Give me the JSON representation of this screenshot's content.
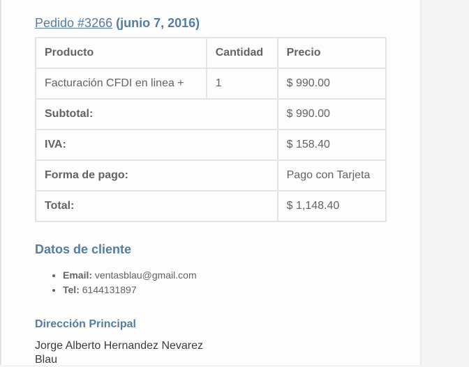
{
  "order": {
    "link_text": "Pedido #3266",
    "date_text": "(junio 7, 2016)"
  },
  "table": {
    "headers": [
      "Producto",
      "Cantidad",
      "Precio"
    ],
    "item": {
      "product": "Facturación CFDI en linea +",
      "quantity": "1",
      "price": "$ 990.00"
    },
    "totals": [
      {
        "label": "Subtotal:",
        "value": "$ 990.00"
      },
      {
        "label": "IVA:",
        "value": "$ 158.40"
      },
      {
        "label": "Forma de pago:",
        "value": "Pago con Tarjeta"
      },
      {
        "label": "Total:",
        "value": "$ 1,148.40"
      }
    ]
  },
  "customer": {
    "title": "Datos de cliente",
    "email_label": "Email:",
    "email_value": "ventasblau@gmail.com",
    "phone_label": "Tel:",
    "phone_value": "6144131897"
  },
  "address": {
    "title": "Dirección Principal",
    "lines": [
      "Jorge Alberto Hernandez Nevarez",
      "Blau"
    ]
  },
  "colors": {
    "accent": "#557da1",
    "text": "#636363",
    "border": "#e4e4e4"
  }
}
